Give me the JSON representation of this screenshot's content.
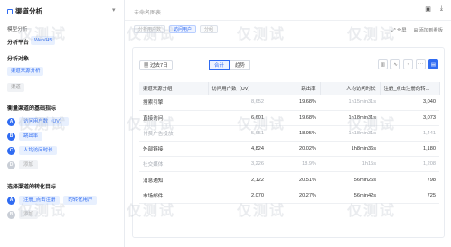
{
  "sidebar": {
    "title": "渠道分析",
    "section_model": "模型分析",
    "platform_label": "分析平台",
    "platform_value": "Web/H5",
    "object_label": "分析对象",
    "object_values": [
      "渠道来源分析",
      "渠道"
    ],
    "dims_label": "衡量渠道的基础指标",
    "dims": [
      {
        "badge": "A",
        "label": "访问用户数（UV）",
        "active": true
      },
      {
        "badge": "B",
        "label": "跳出率",
        "active": true
      },
      {
        "badge": "C",
        "label": "人均访问时长",
        "active": true
      },
      {
        "badge": "D",
        "label": "添加",
        "active": false
      }
    ],
    "conversion_label": "选择渠道的转化目标",
    "conversion": [
      {
        "badge": "A",
        "tag1": "注册_点击注册",
        "tag2": "的转化用户",
        "active": true
      },
      {
        "badge": "B",
        "tag1": "添加",
        "tag2": "",
        "active": false
      }
    ]
  },
  "header": {
    "title": "未命名图表",
    "chips": [
      "分析用户数",
      "访问用户",
      "分组"
    ],
    "actions": [
      "全屏",
      "添加到看板"
    ]
  },
  "toolbar": {
    "date_range": "过去7日",
    "seg": [
      "合计",
      "趋势"
    ]
  },
  "table": {
    "headers": [
      "渠道来源分组",
      "访问用户数（UV）",
      "跳出率",
      "人均访问时长",
      "注册_点击注册的转..."
    ],
    "rows": [
      [
        "搜索引擎",
        "8,652",
        "19.68%",
        "1h15min31s",
        "3,040"
      ],
      [
        "直接访问",
        "6,601",
        "19.68%",
        "1h18min31s",
        "3,073"
      ],
      [
        "付费广告投放",
        "5,651",
        "18.95%",
        "1h18min31s",
        "1,441"
      ],
      [
        "外部链接",
        "4,824",
        "20.02%",
        "1h8min36s",
        "1,180"
      ],
      [
        "社交媒体",
        "3,226",
        "18.9%",
        "1h15s",
        "1,208"
      ],
      [
        "消息通知",
        "2,122",
        "20.51%",
        "56min26s",
        "798"
      ],
      [
        "市场邮件",
        "2,070",
        "20.27%",
        "56min42s",
        "725"
      ]
    ]
  },
  "watermark": "仅测试"
}
